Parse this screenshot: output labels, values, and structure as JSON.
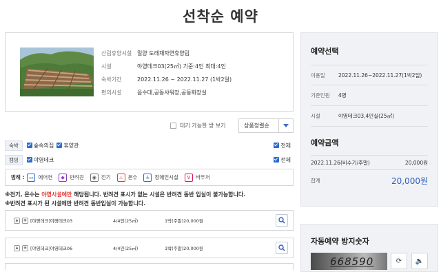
{
  "page": {
    "title": "선착순 예약"
  },
  "facility": {
    "rows": [
      {
        "key": "산림휴양시설",
        "value": "밀양 도래재자연휴양림"
      },
      {
        "key": "시설",
        "value": "야영데크03(25㎡) 기준:4인 최대:4인"
      },
      {
        "key": "숙박기간",
        "value": "2022.11.26 ~ 2022.11.27 (1박2일)"
      },
      {
        "key": "편의시설",
        "value": "음수대,공동샤워장,공동화장실"
      }
    ]
  },
  "toolbar": {
    "waiting_label": "대기 가능한 방 보기",
    "sort_label": "상품정렬순"
  },
  "filters": [
    {
      "tag": "숙박",
      "checks": [
        "숲속의집",
        "휴양관"
      ],
      "all": "전체"
    },
    {
      "tag": "캠핑",
      "checks": [
        "야영데크"
      ],
      "all": "전체"
    }
  ],
  "legend": {
    "title": "범례 :",
    "items": [
      {
        "label": "에어컨",
        "icon": "air-conditioner-icon",
        "color": "#2f6bd1"
      },
      {
        "label": "반려견",
        "icon": "dog-icon",
        "color": "#8e3cc4"
      },
      {
        "label": "전기",
        "icon": "electric-plug-icon",
        "color": "#555555"
      },
      {
        "label": "온수",
        "icon": "hot-water-icon",
        "color": "#e53935"
      },
      {
        "label": "장애인시설",
        "icon": "wheelchair-icon",
        "color": "#2f6bd1"
      },
      {
        "label": "바우처",
        "icon": "voucher-icon",
        "color": "#d81b60"
      }
    ]
  },
  "notice": {
    "line1_prefix": "※전기, 온수는 ",
    "line1_highlight": "야영시설예만",
    "line1_suffix": " 해당됩니다. 반려견 표시가 없는 시설은 반려견 동반 입실이 불가능합니다.",
    "line2": "※반려견 표시가 된 시설에만 반려견 동반입실이 가능합니다."
  },
  "results": [
    {
      "name": "[야영데크]야영데크03",
      "area": "4/4인(25㎡)",
      "price": "1박(주말)20,000원"
    },
    {
      "name": "[야영데크]야영데크06",
      "area": "4/4인(25㎡)",
      "price": "1박(주말)20,000원"
    }
  ],
  "selection": {
    "title": "예약선택",
    "rows": [
      {
        "key": "이용일",
        "value": "2022.11.26~2022.11.27(1박2일)"
      },
      {
        "key": "기준인원",
        "value": "4명"
      },
      {
        "key": "시설",
        "value": "야영데크03,4인실(25㎡)"
      }
    ]
  },
  "amount": {
    "title": "예약금액",
    "line_label": "2022.11.26(비수기/주말)",
    "line_value": "20,000원",
    "total_label": "합계",
    "total_value": "20,000원"
  },
  "captcha": {
    "title": "자동예약 방지숫자",
    "code": "668590",
    "refresh_icon": "refresh-icon",
    "audio_icon": "speaker-icon"
  },
  "colors": {
    "accent": "#2f5fbf",
    "highlight": "#e53935",
    "panel_bg": "#f1f2f5"
  }
}
